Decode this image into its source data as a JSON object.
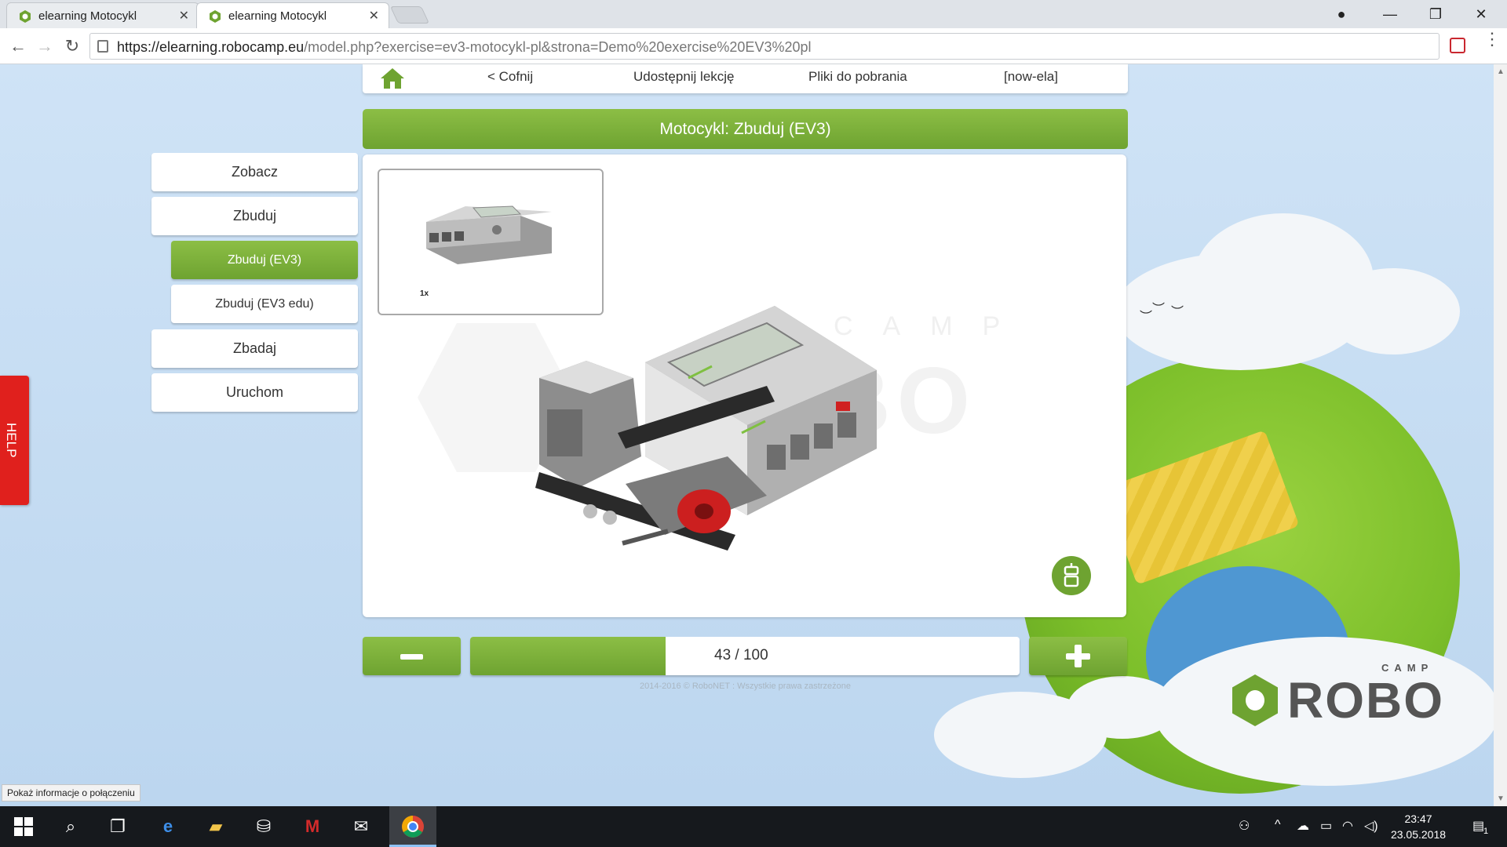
{
  "browser": {
    "tabs": [
      {
        "title": "elearning Motocykl",
        "active": false
      },
      {
        "title": "elearning Motocykl",
        "active": true
      }
    ],
    "url_host": "https://elearning.robocamp.eu",
    "url_path": "/model.php?exercise=ev3-motocykl-pl&strona=Demo%20exercise%20EV3%20pl",
    "status_text": "Pokaż informacje o połączeniu"
  },
  "nav": {
    "back": "< Cofnij",
    "share": "Udostępnij lekcję",
    "downloads": "Pliki do pobrania",
    "user": "[now-ela]"
  },
  "lesson": {
    "title": "Motocykl: Zbuduj (EV3)",
    "parts_qty": "1x",
    "watermark": "ROBO",
    "watermark_small": "CAMP"
  },
  "menu": {
    "see": "Zobacz",
    "build": "Zbuduj",
    "build_ev3": "Zbuduj (EV3)",
    "build_ev3_edu": "Zbuduj (EV3 edu)",
    "explore": "Zbadaj",
    "run": "Uruchom"
  },
  "pagination": {
    "current": 43,
    "total": 100,
    "label": "43 / 100",
    "progress_fraction": 0.355
  },
  "footer": {
    "copyright": "2014-2016 © RoboNET : Wszystkie prawa zastrzeżone"
  },
  "help": {
    "label": "HELP"
  },
  "logo": {
    "word": "ROBO",
    "small": "CAMP"
  },
  "taskbar": {
    "time": "23:47",
    "date": "23.05.2018",
    "notifications": "1"
  },
  "colors": {
    "accent_green": "#6ea331",
    "help_red": "#e0201d",
    "sky": "#cfe3f6"
  }
}
